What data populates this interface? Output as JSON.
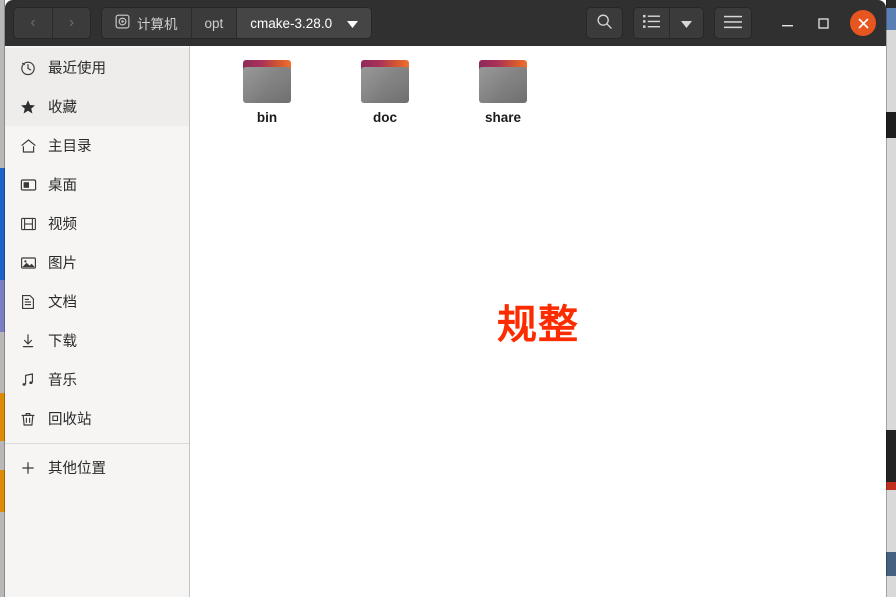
{
  "window": {
    "title": "cmake-3.28.0",
    "accent_close_color": "#e8561f",
    "header_bg": "#303030",
    "sidebar_bg": "#f6f5f4",
    "content_bg": "#ffffff"
  },
  "toolbar": {
    "back_label": "‹",
    "forward_label": "›",
    "search_icon": "search-icon",
    "list_view_icon": "list-view-icon",
    "view_dropdown_icon": "chevron-down-icon",
    "menu_icon": "hamburger-menu-icon",
    "minimize_label": "–",
    "maximize_label": "□",
    "close_label": "✕"
  },
  "breadcrumb": {
    "items": [
      {
        "label": "计算机",
        "icon": "disc-icon",
        "active": false
      },
      {
        "label": "opt",
        "icon": "",
        "active": false
      },
      {
        "label": "cmake-3.28.0",
        "icon": "",
        "active": true,
        "has_dropdown": true
      }
    ]
  },
  "sidebar": {
    "items": [
      {
        "label": "最近使用",
        "icon": "clock-icon",
        "shaded": true
      },
      {
        "label": "收藏",
        "icon": "star-icon",
        "shaded": true
      },
      {
        "label": "主目录",
        "icon": "home-icon",
        "shaded": false
      },
      {
        "label": "桌面",
        "icon": "desktop-icon",
        "shaded": false
      },
      {
        "label": "视频",
        "icon": "video-icon",
        "shaded": false
      },
      {
        "label": "图片",
        "icon": "pictures-icon",
        "shaded": false
      },
      {
        "label": "文档",
        "icon": "document-icon",
        "shaded": false
      },
      {
        "label": "下载",
        "icon": "download-icon",
        "shaded": false
      },
      {
        "label": "音乐",
        "icon": "music-icon",
        "shaded": false
      },
      {
        "label": "回收站",
        "icon": "trash-icon",
        "shaded": false
      }
    ],
    "other_locations": {
      "label": "其他位置",
      "icon": "plus-icon"
    }
  },
  "files": {
    "items": [
      {
        "name": "bin",
        "type": "folder"
      },
      {
        "name": "doc",
        "type": "folder"
      },
      {
        "name": "share",
        "type": "folder"
      }
    ]
  },
  "annotation": {
    "text": "规整",
    "color": "#fc2c00"
  }
}
